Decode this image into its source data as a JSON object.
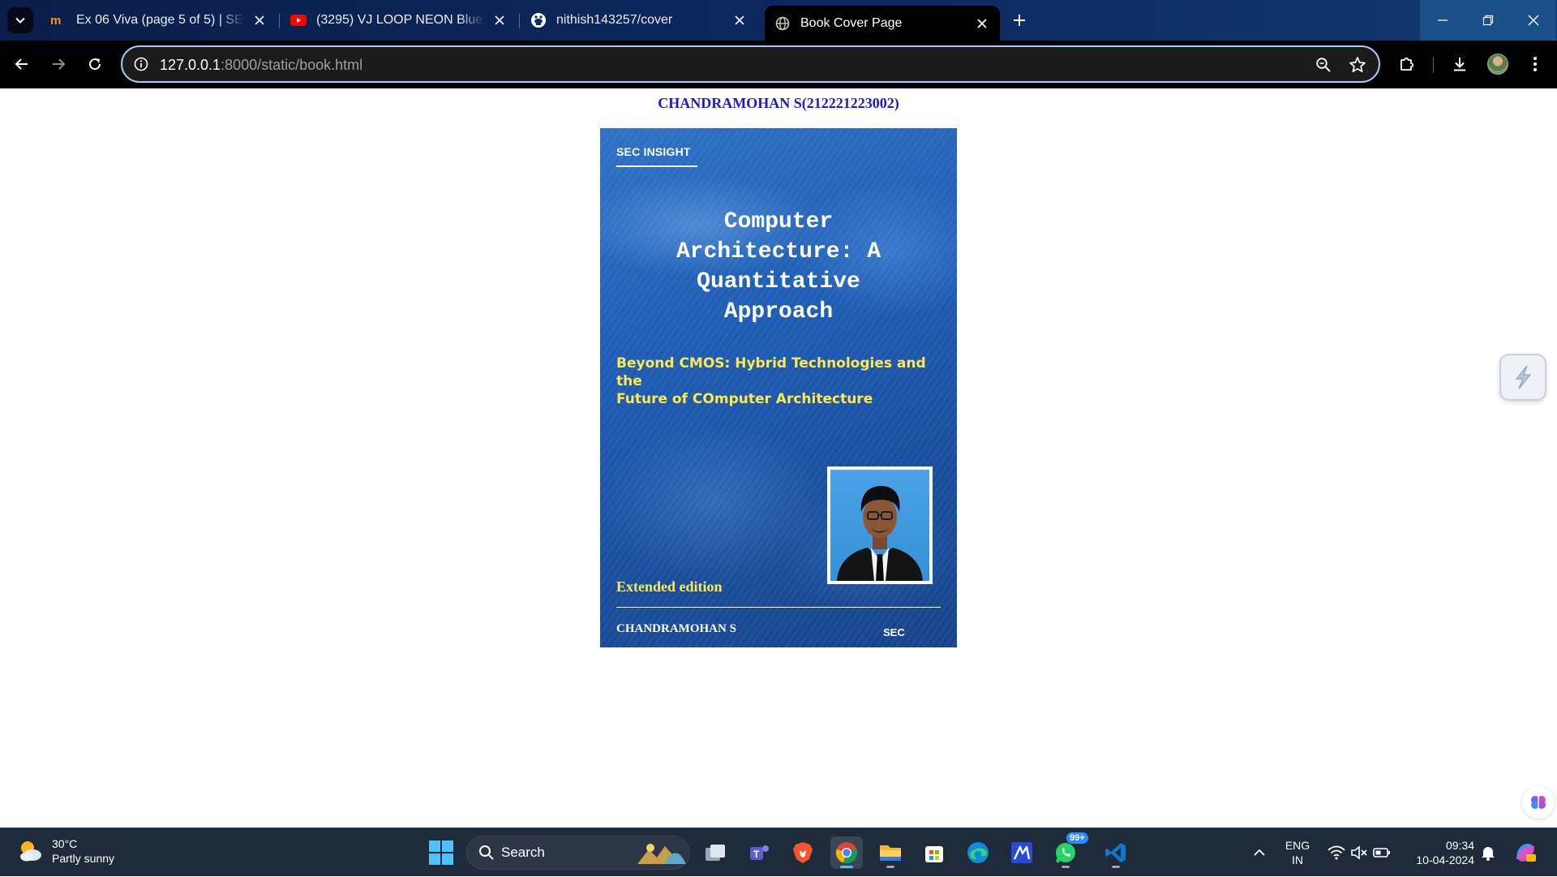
{
  "browser": {
    "tabs": [
      {
        "title": "Ex 06 Viva (page 5 of 5) | SEC",
        "icon": "moodle-icon",
        "active": false
      },
      {
        "title": "(3295) VJ LOOP NEON Blue Metal",
        "icon": "youtube-icon",
        "active": false
      },
      {
        "title": "nithish143257/cover",
        "icon": "github-icon",
        "active": false
      },
      {
        "title": "Book Cover Page",
        "icon": "globe-icon",
        "active": true
      }
    ],
    "url": {
      "host": "127.0.0.1",
      "rest": ":8000/static/book.html"
    },
    "accent": "#a8c7fa"
  },
  "page": {
    "heading": "CHANDRAMOHAN S(212221223002)"
  },
  "cover": {
    "publisher": "SEC INSIGHT",
    "title_lines": [
      "Computer",
      "Architecture: A",
      "Quantitative",
      "Approach"
    ],
    "subtitle_lines": [
      "Beyond CMOS: Hybrid Technologies and the",
      "Future of COmputer Architecture"
    ],
    "edition": "Extended edition",
    "author": "CHANDRAMOHAN S",
    "imprint": "SEC",
    "colors": {
      "title": "#ffffff",
      "subtitle": "#ffe94a",
      "background": "#1e5cb3"
    }
  },
  "taskbar": {
    "weather": {
      "temp": "30°C",
      "condition": "Partly sunny"
    },
    "search_label": "Search",
    "apps": [
      "task-view-icon",
      "teams-icon",
      "brave-icon",
      "chrome-icon",
      "file-explorer-icon",
      "store-icon",
      "edge-icon",
      "remote-icon",
      "whatsapp-icon",
      "vscode-icon"
    ],
    "whatsapp_badge": "99+",
    "lang_top": "ENG",
    "lang_bottom": "IN",
    "time": "09:34",
    "date": "10-04-2024"
  }
}
